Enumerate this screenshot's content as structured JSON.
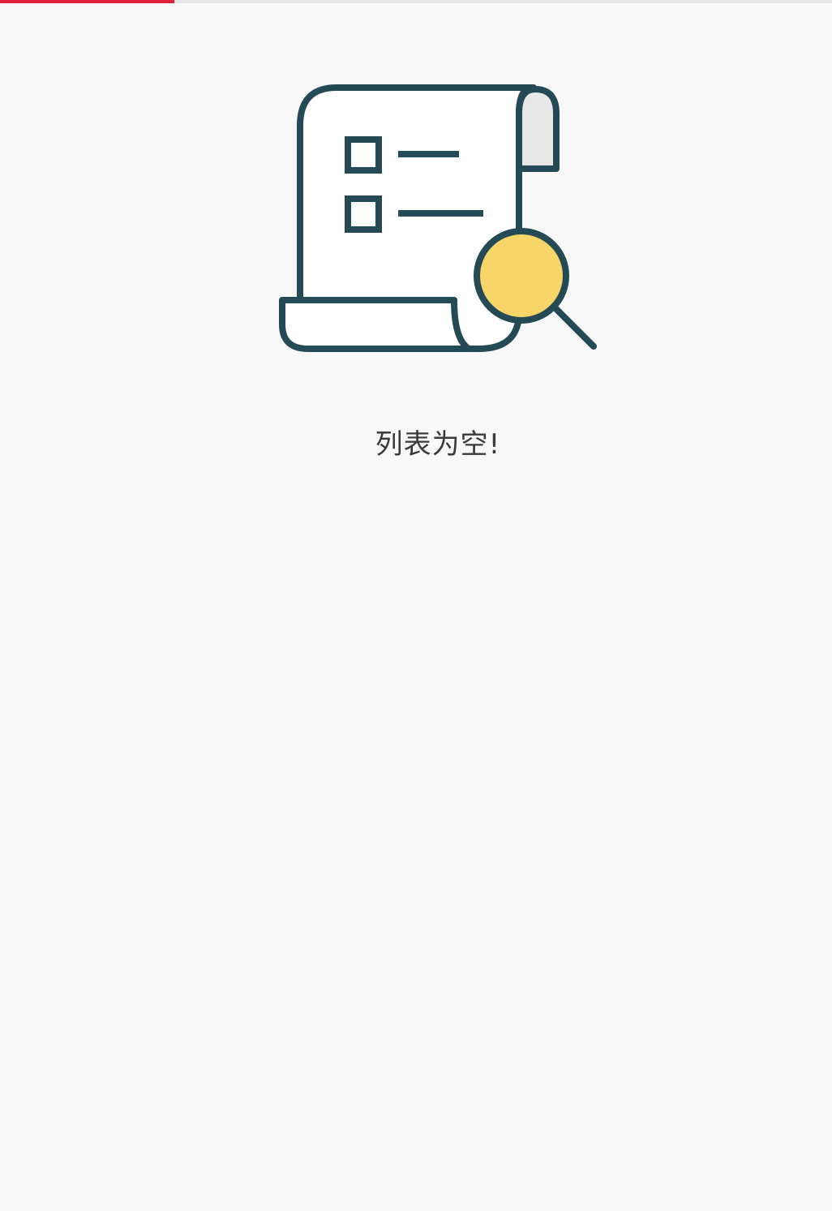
{
  "progress": {
    "value": 0.21,
    "color": "#e3203a",
    "track_color": "#e6e6e6"
  },
  "empty_state": {
    "icon": "document-search-icon",
    "message": "列表为空!",
    "colors": {
      "outline": "#244a56",
      "magnifier": "#f8d568",
      "paper": "#ffffff",
      "fold": "#e8e8e8"
    }
  }
}
